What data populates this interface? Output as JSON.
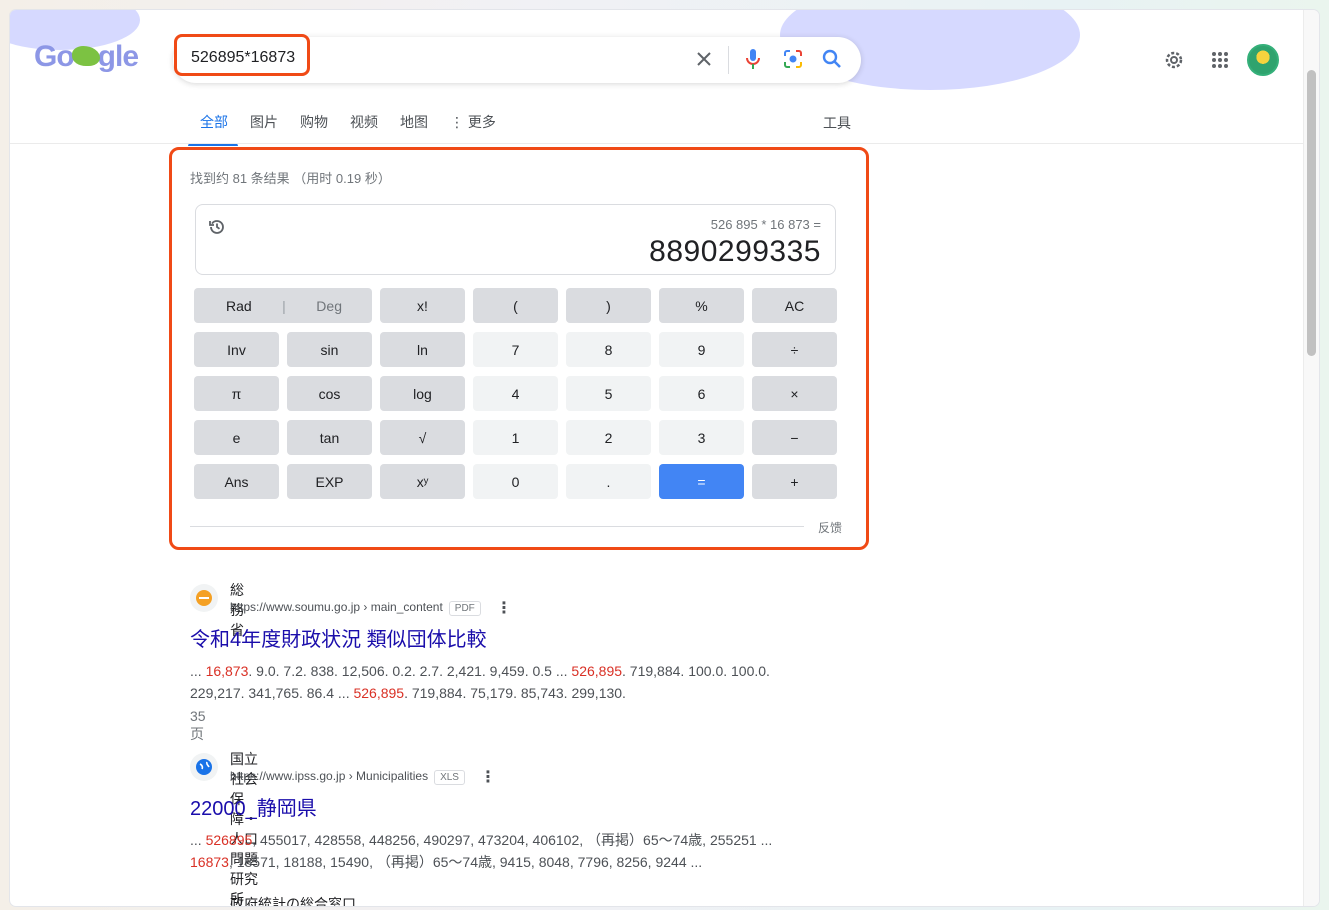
{
  "search": {
    "query": "526895*16873"
  },
  "logo_text": "Google",
  "tabs": [
    {
      "label": "全部",
      "active": true
    },
    {
      "label": "图片",
      "active": false
    },
    {
      "label": "购物",
      "active": false
    },
    {
      "label": "视频",
      "active": false
    },
    {
      "label": "地图",
      "active": false
    },
    {
      "label": "⋮ 更多",
      "active": false
    }
  ],
  "tools_label": "工具",
  "result_stats": "找到约 81 条结果 （用时 0.19 秒）",
  "calculator": {
    "expression": "526 895 * 16 873 =",
    "result": "8890299335",
    "feedback": "反馈",
    "keys": [
      [
        "x!",
        "(",
        ")",
        "%",
        "AC"
      ],
      [
        "Inv",
        "sin",
        "ln",
        "7",
        "8",
        "9",
        "÷"
      ],
      [
        "π",
        "cos",
        "log",
        "4",
        "5",
        "6",
        "×"
      ],
      [
        "e",
        "tan",
        "√",
        "1",
        "2",
        "3",
        "−"
      ],
      [
        "Ans",
        "EXP",
        "xʸ",
        "0",
        ".",
        "=",
        "+"
      ]
    ],
    "rad": "Rad",
    "deg": "Deg"
  },
  "results": [
    {
      "site": "総務省",
      "url": "https://www.soumu.go.jp › main_content",
      "badge": "PDF",
      "title": "令和4年度財政状況 類似団体比較",
      "snippet_line1": [
        "... ",
        "16,873",
        ". 9.0. 7.2. 838. 12,506. 0.2. 2.7. 2,421. 9,459. 0.5 ... ",
        "526,895",
        ". 719,884. 100.0. 100.0."
      ],
      "snippet_line2": [
        "229,217. 341,765. 86.4 ... ",
        "526,895",
        ". 719,884. 75,179. 85,743. 299,130."
      ],
      "meta": "35 页"
    },
    {
      "site": "国立社会保障・人口問題研究所",
      "url": "https://www.ipss.go.jp › Municipalities",
      "badge": "XLS",
      "title": "22000_静岡県",
      "snippet_line1": [
        "... ",
        "526895",
        ", 455017, 428558, 448256, 490297, 473204, 406102, （再掲）65〜74歳, 255251 ..."
      ],
      "snippet_line2": [
        "",
        "16873",
        ", 18571, 18188, 15490, （再掲）65〜74歳, 9415, 8048, 7796, 8256, 9244 ..."
      ]
    }
  ],
  "partial_next_site": "政府統計の総合窓口"
}
